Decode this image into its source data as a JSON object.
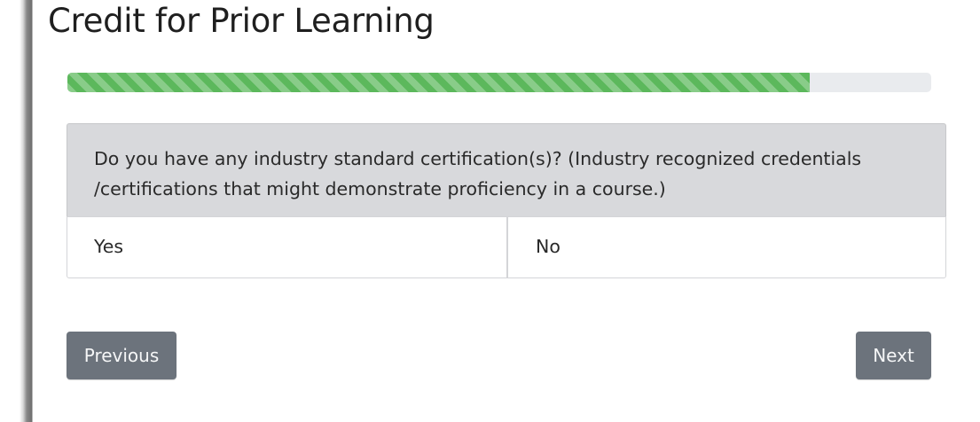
{
  "page": {
    "title": "Credit for Prior Learning"
  },
  "progress": {
    "value_fraction": 0.859,
    "fill_color": "#5cb85c",
    "track_color": "#e9ebee"
  },
  "question": {
    "text_line1": "Do you have any industry standard certification(s)? (Industry recognized credentials",
    "text_line2": "/certifications that might demonstrate proficiency in a course.)",
    "options": [
      {
        "label": "Yes"
      },
      {
        "label": "No"
      }
    ]
  },
  "navigation": {
    "previous_label": "Previous",
    "next_label": "Next",
    "button_color": "#6c737c"
  }
}
